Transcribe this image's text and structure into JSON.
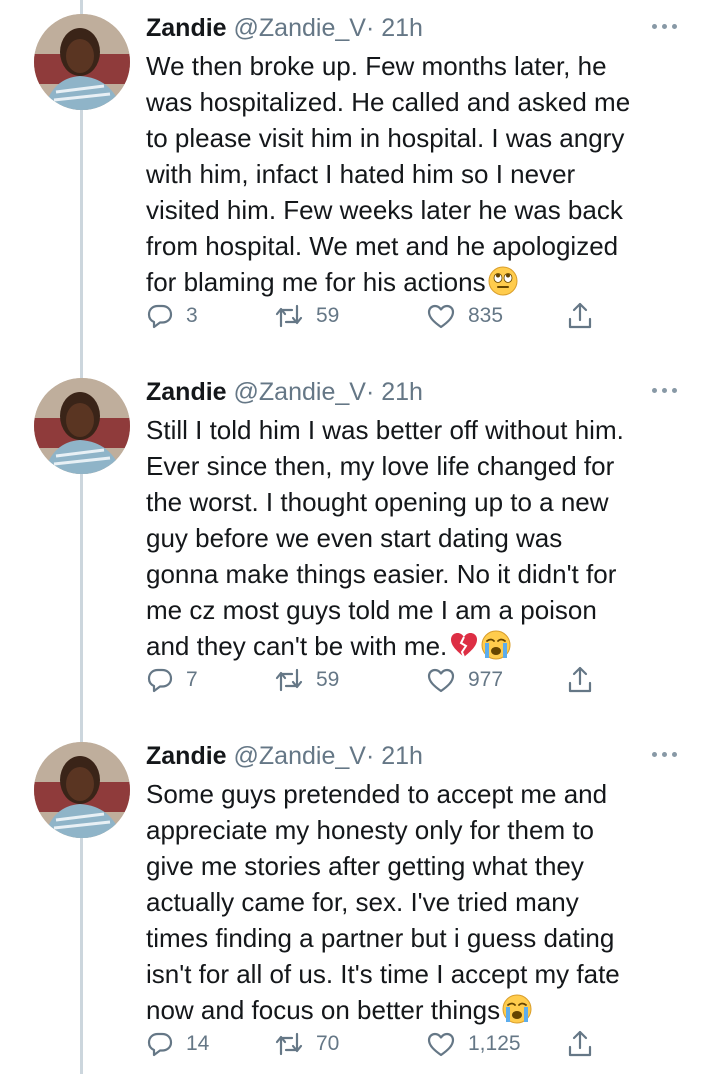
{
  "tweets": [
    {
      "name": "Zandie",
      "handle": "@Zandie_V",
      "time": "· 21h",
      "text": "We then broke up. Few months later, he\nwas hospitalized. He called and asked me\nto please visit him in hospital. I was angry\nwith him, infact I hated him so I never\nvisited him. Few weeks later he was back\nfrom hospital. We met and he apologized\nfor blaming me for his actions",
      "emojis": [
        "eye-roll-emoji"
      ],
      "replies": "3",
      "retweets": "59",
      "likes": "835"
    },
    {
      "name": "Zandie",
      "handle": "@Zandie_V",
      "time": "· 21h",
      "text": "Still I told him I was better off without him.\nEver since then, my love life changed for\nthe worst. I thought opening up to a new\nguy before we even start dating was\ngonna make things easier. No it didn't for\nme cz most guys told me I am a poison\nand they can't be with me.",
      "emojis": [
        "broken-heart-emoji",
        "crying-face-emoji"
      ],
      "replies": "7",
      "retweets": "59",
      "likes": "977"
    },
    {
      "name": "Zandie",
      "handle": "@Zandie_V",
      "time": "· 21h",
      "text": "Some guys pretended to accept me and\nappreciate my honesty only for them to\ngive me stories after getting what they\nactually came for, sex. I've tried many\ntimes finding a partner but i guess dating\nisn't for all of us. It's time I accept my fate\nnow and focus on better things",
      "emojis": [
        "crying-face-emoji"
      ],
      "replies": "14",
      "retweets": "70",
      "likes": "1,125"
    }
  ],
  "colors": {
    "text": "#14171a",
    "secondary": "#657786",
    "thread_line": "#ccd6dd"
  },
  "icons": [
    "reply-icon",
    "retweet-icon",
    "like-icon",
    "share-icon",
    "more-options-icon"
  ]
}
